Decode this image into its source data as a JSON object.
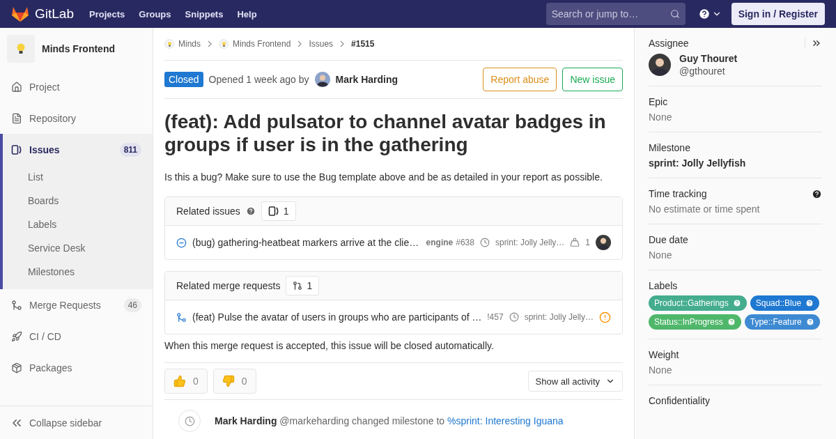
{
  "navbar": {
    "brand": "GitLab",
    "links": [
      "Projects",
      "Groups",
      "Snippets",
      "Help"
    ],
    "search": {
      "placeholder": "Search or jump to…"
    },
    "sign_in": "Sign in / Register"
  },
  "sidebar": {
    "project": "Minds Frontend",
    "items": [
      {
        "label": "Project",
        "selected": false
      },
      {
        "label": "Repository",
        "selected": false
      },
      {
        "label": "Issues",
        "count": "811",
        "selected": true,
        "children": [
          {
            "label": "List",
            "selected": false
          },
          {
            "label": "Boards",
            "selected": false
          },
          {
            "label": "Labels",
            "selected": false
          },
          {
            "label": "Service Desk",
            "selected": false
          },
          {
            "label": "Milestones",
            "selected": false
          }
        ]
      },
      {
        "label": "Merge Requests",
        "count": "46",
        "selected": false
      },
      {
        "label": "CI / CD",
        "selected": false
      },
      {
        "label": "Packages",
        "selected": false
      }
    ],
    "collapse": "Collapse sidebar"
  },
  "breadcrumbs": [
    "Minds",
    "Minds Frontend",
    "Issues",
    "#1515"
  ],
  "issue": {
    "status": "Closed",
    "meta": "Opened 1 week ago by",
    "author": "Mark Harding",
    "buttons": [
      {
        "label": "Report abuse",
        "kind": "warning"
      },
      {
        "label": "New issue",
        "kind": "success"
      }
    ],
    "title": "(feat): Add pulsator to channel avatar badges in groups if user is in the gathering",
    "description": "Is this a bug? Make sure to use the Bug template above and be as detailed in your report as possible."
  },
  "related_issues": {
    "title": "Related issues",
    "count": "1",
    "items": [
      {
        "title": "(bug) gathering-heatbeat markers arrive at the clie…",
        "ref": "**engine**#638",
        "milestone": "sprint: Jolly Jelly…",
        "weight": "1"
      }
    ]
  },
  "related_merge_requests": {
    "title": "Related merge requests",
    "count": "1",
    "items": [
      {
        "title": "(feat) Pulse the avatar of users in groups who are participants of …",
        "ref": "!457",
        "milestone": "sprint: Jolly Jelly…"
      }
    ],
    "note": "When this merge request is accepted, this issue will be closed automatically."
  },
  "awards": [
    {
      "kind": "thumbsup",
      "count": "0"
    },
    {
      "kind": "thumbsdown",
      "count": "0"
    }
  ],
  "activity_filter": "Show all activity",
  "activity": [
    {
      "author": "Mark Harding",
      "handle": "@markeharding",
      "action": "changed milestone to",
      "link": "%sprint: Interesting Iguana"
    }
  ],
  "right_sidebar": {
    "assignee": {
      "label": "Assignee",
      "name": "Guy Thouret",
      "handle": "@gthouret"
    },
    "sections": [
      {
        "kind": "plain",
        "label": "Epic",
        "value": "None"
      },
      {
        "kind": "strong",
        "label": "Milestone",
        "value": "sprint: Jolly Jellyfish"
      },
      {
        "kind": "help",
        "label": "Time tracking",
        "value": "No estimate or time spent"
      },
      {
        "kind": "plain",
        "label": "Due date",
        "value": "None"
      },
      {
        "kind": "labels",
        "label": "Labels",
        "labels": [
          {
            "text": "Product::Gatherings",
            "color": "#44ad8e"
          },
          {
            "text": "Squad::Blue",
            "color": "#1f78d1"
          },
          {
            "text": "Status::InProgress",
            "color": "#4fb76a"
          },
          {
            "text": "Type::Feature",
            "color": "#3e8ad2"
          }
        ]
      },
      {
        "kind": "plain",
        "label": "Weight",
        "value": "None"
      },
      {
        "kind": "heading",
        "label": "Confidentiality"
      }
    ]
  }
}
